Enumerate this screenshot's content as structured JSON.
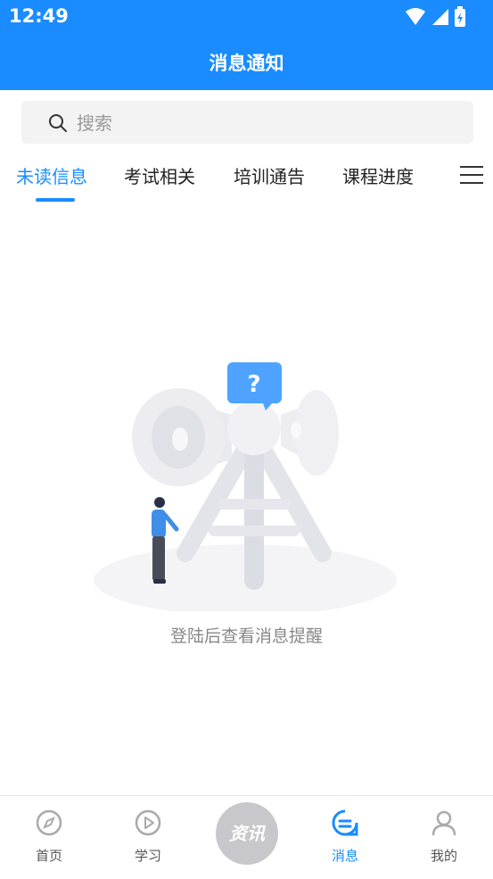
{
  "status_bar": {
    "time": "12:49"
  },
  "header": {
    "title": "消息通知"
  },
  "search": {
    "placeholder": "搜索"
  },
  "tabs": [
    {
      "label": "未读信息",
      "active": true
    },
    {
      "label": "考试相关",
      "active": false
    },
    {
      "label": "培训通告",
      "active": false
    },
    {
      "label": "课程进度",
      "active": false
    }
  ],
  "empty_state": {
    "message": "登陆后查看消息提醒"
  },
  "bottom_nav": {
    "items": [
      {
        "label": "首页",
        "icon": "compass-icon"
      },
      {
        "label": "学习",
        "icon": "play-icon"
      },
      {
        "label": "资讯",
        "icon": "news-center-button"
      },
      {
        "label": "消息",
        "icon": "message-icon",
        "active": true
      },
      {
        "label": "我的",
        "icon": "user-icon"
      }
    ]
  },
  "colors": {
    "primary": "#1a8cff",
    "inactive": "#555555",
    "center_button": "#c8c8cc"
  }
}
